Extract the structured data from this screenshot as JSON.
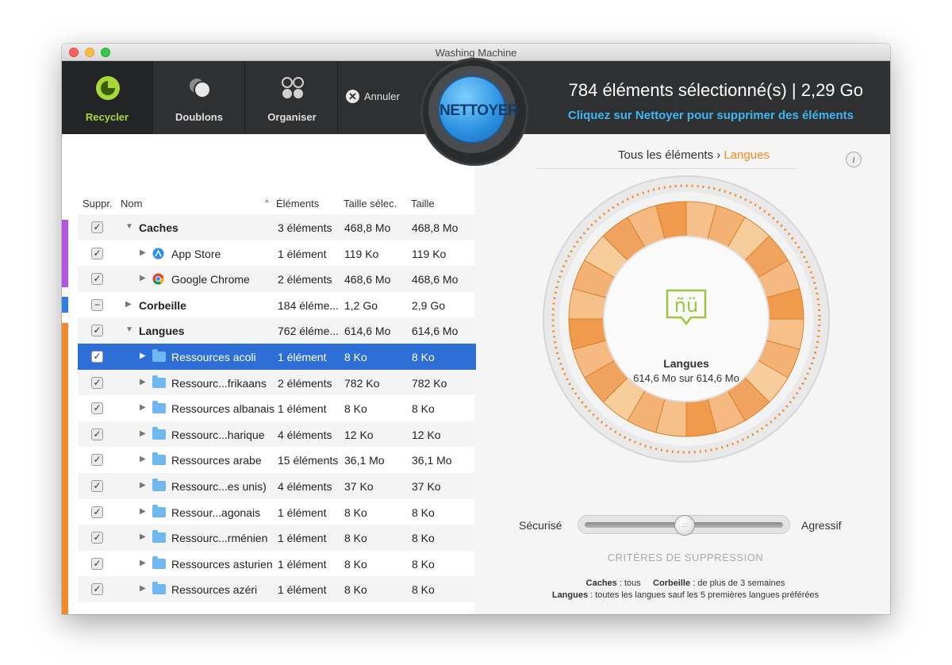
{
  "window": {
    "title": "Washing Machine"
  },
  "toolbar": {
    "tabs": [
      {
        "label": "Recycler",
        "icon": "recycle-icon",
        "active": true
      },
      {
        "label": "Doublons",
        "icon": "duplicates-icon",
        "active": false
      },
      {
        "label": "Organiser",
        "icon": "organize-icon",
        "active": false
      }
    ],
    "cancel_label": "Annuler",
    "clean_button": "NETTOYER",
    "summary": "784 éléments sélectionné(s) | 2,29 Go",
    "hint": "Cliquez sur Nettoyer pour supprimer des éléments"
  },
  "table": {
    "headers": {
      "suppr": "Suppr.",
      "name": "Nom",
      "elements": "Éléments",
      "sel_size": "Taille sélec.",
      "size": "Taille"
    },
    "sort_indicator": "^",
    "rows": [
      {
        "name": "Caches",
        "elements": "3 éléments",
        "sel_size": "468,8 Mo",
        "size": "468,8 Mo",
        "check": "✓",
        "expand": "▼",
        "level": 0,
        "bold": true,
        "icon": ""
      },
      {
        "name": "App Store",
        "elements": "1 élément",
        "sel_size": "119 Ko",
        "size": "119 Ko",
        "check": "✓",
        "expand": "▶",
        "level": 1,
        "bold": false,
        "icon": "app-store-icon"
      },
      {
        "name": "Google Chrome",
        "elements": "2 éléments",
        "sel_size": "468,6 Mo",
        "size": "468,6 Mo",
        "check": "✓",
        "expand": "▶",
        "level": 1,
        "bold": false,
        "icon": "chrome-icon"
      },
      {
        "name": "Corbeille",
        "elements": "184 éléme...",
        "sel_size": "1,2 Go",
        "size": "2,9 Go",
        "check": "−",
        "expand": "▶",
        "level": 0,
        "bold": true,
        "icon": ""
      },
      {
        "name": "Langues",
        "elements": "762 éléme...",
        "sel_size": "614,6 Mo",
        "size": "614,6 Mo",
        "check": "✓",
        "expand": "▼",
        "level": 0,
        "bold": true,
        "icon": ""
      },
      {
        "name": "Ressources acoli",
        "elements": "1 élément",
        "sel_size": "8 Ko",
        "size": "8 Ko",
        "check": "✓",
        "expand": "▶",
        "level": 1,
        "bold": false,
        "icon": "folder-icon",
        "selected": true
      },
      {
        "name": "Ressourc...frikaans",
        "elements": "2 éléments",
        "sel_size": "782 Ko",
        "size": "782 Ko",
        "check": "✓",
        "expand": "▶",
        "level": 1,
        "bold": false,
        "icon": "folder-icon"
      },
      {
        "name": "Ressources albanais",
        "elements": "1 élément",
        "sel_size": "8 Ko",
        "size": "8 Ko",
        "check": "✓",
        "expand": "▶",
        "level": 1,
        "bold": false,
        "icon": "folder-icon"
      },
      {
        "name": "Ressourc...harique",
        "elements": "4 éléments",
        "sel_size": "12 Ko",
        "size": "12 Ko",
        "check": "✓",
        "expand": "▶",
        "level": 1,
        "bold": false,
        "icon": "folder-icon"
      },
      {
        "name": "Ressources arabe",
        "elements": "15 éléments",
        "sel_size": "36,1 Mo",
        "size": "36,1 Mo",
        "check": "✓",
        "expand": "▶",
        "level": 1,
        "bold": false,
        "icon": "folder-icon"
      },
      {
        "name": "Ressourc...es unis)",
        "elements": "4 éléments",
        "sel_size": "37 Ko",
        "size": "37 Ko",
        "check": "✓",
        "expand": "▶",
        "level": 1,
        "bold": false,
        "icon": "folder-icon"
      },
      {
        "name": "Ressour...agonais",
        "elements": "1 élément",
        "sel_size": "8 Ko",
        "size": "8 Ko",
        "check": "✓",
        "expand": "▶",
        "level": 1,
        "bold": false,
        "icon": "folder-icon"
      },
      {
        "name": "Ressourc...rménien",
        "elements": "1 élément",
        "sel_size": "8 Ko",
        "size": "8 Ko",
        "check": "✓",
        "expand": "▶",
        "level": 1,
        "bold": false,
        "icon": "folder-icon"
      },
      {
        "name": "Ressources asturien",
        "elements": "1 élément",
        "sel_size": "8 Ko",
        "size": "8 Ko",
        "check": "✓",
        "expand": "▶",
        "level": 1,
        "bold": false,
        "icon": "folder-icon"
      },
      {
        "name": "Ressources azéri",
        "elements": "1 élément",
        "sel_size": "8 Ko",
        "size": "8 Ko",
        "check": "✓",
        "expand": "▶",
        "level": 1,
        "bold": false,
        "icon": "folder-icon"
      }
    ],
    "category_colors": {
      "caches": "#b455e0",
      "corbeille": "#2f7fe0",
      "langues": "#f08a2a"
    }
  },
  "right": {
    "breadcrumb_root": "Tous les éléments",
    "breadcrumb_sep": "›",
    "breadcrumb_current": "Langues",
    "info_label": "i",
    "drum_label": "Langues",
    "drum_value": "614,6 Mo sur 614,6 Mo",
    "drum_icon_text": "ñü",
    "drum_icon": "languages-icon",
    "slider": {
      "left_label": "Sécurisé",
      "right_label": "Agressif",
      "level": 0.5
    },
    "criteria_label": "CRITÈRES DE SUPPRESSION",
    "rules": {
      "caches_key": "Caches",
      "caches_val": " : tous",
      "corbeille_key": "Corbeille",
      "corbeille_val": " : de plus de 3 semaines",
      "langues_key": "Langues",
      "langues_val": " : toutes les langues sauf les 5 premières langues préférées"
    },
    "accent_color": "#f08a1f"
  }
}
